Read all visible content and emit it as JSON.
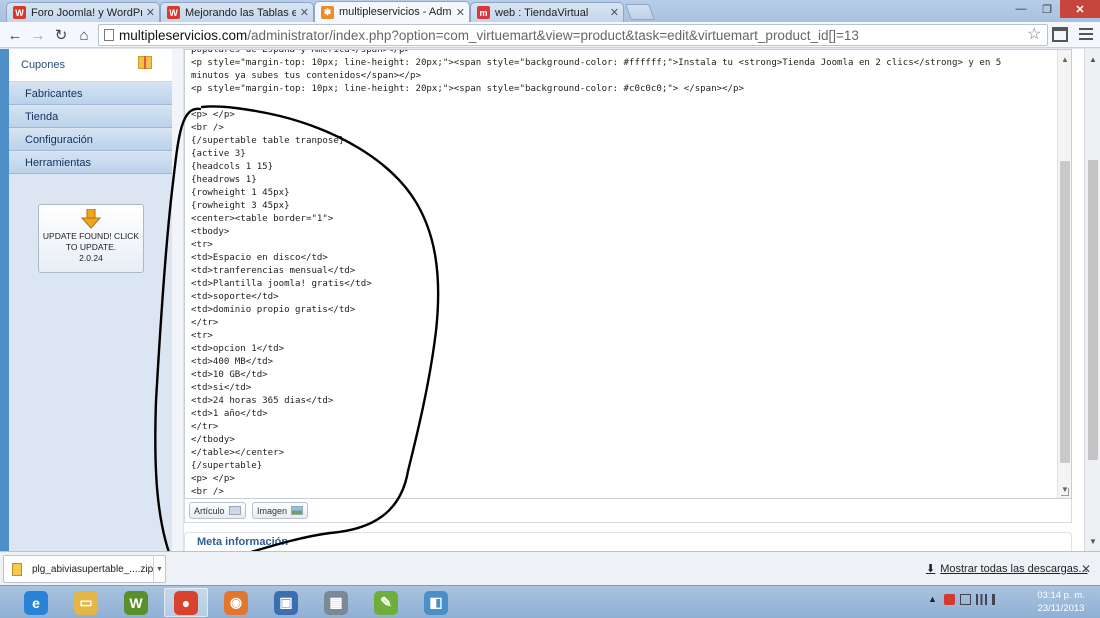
{
  "browser": {
    "tabs": [
      {
        "title": "Foro Joomla! y WordPress",
        "icon": "wordpress-favicon",
        "icon_letter": "W",
        "color": "#d9392c",
        "active": false
      },
      {
        "title": "Mejorando las Tablas en a",
        "icon": "wordpress-favicon",
        "icon_letter": "W",
        "color": "#d9392c",
        "active": false
      },
      {
        "title": "multipleservicios - Admin",
        "icon": "joomla-favicon",
        "icon_letter": "✱",
        "color": "#f08a24",
        "active": true
      },
      {
        "title": "web : TiendaVirtual",
        "icon": "m-favicon",
        "icon_letter": "m",
        "color": "#d63a3a",
        "active": false
      }
    ],
    "address": {
      "host": "multipleservicios.com",
      "rest": "/administrator/index.php?option=com_virtuemart&view=product&task=edit&virtuemart_product_id[]=13"
    }
  },
  "sidebar": {
    "coupon_label": "Cupones",
    "items": [
      "Fabricantes",
      "Tienda",
      "Configuración",
      "Herramientas"
    ],
    "update": {
      "line1": "UPDATE FOUND! CLICK",
      "line2": "TO UPDATE.",
      "version": "2.0.24"
    }
  },
  "editor": {
    "lines": [
      "populares de España y América</span></p>",
      "<p style=\"margin-top: 10px; line-height: 20px;\"><span style=\"background-color: #ffffff;\">Instala tu <strong>Tienda Joomla en 2 clics</strong> y en 5",
      "minutos ya subes tus contenidos</span></p>",
      "<p style=\"margin-top: 10px; line-height: 20px;\"><span style=\"background-color: #c0c0c0;\"> </span></p>",
      "",
      "<p> </p>",
      "<br />",
      "{/supertable table tranpose}",
      "{active 3}",
      "{headcols 1 15}",
      "{headrows 1}",
      "{rowheight 1 45px}",
      "{rowheight 3 45px}",
      "<center><table border=\"1\">",
      "<tbody>",
      "<tr>",
      "<td>Espacio en disco</td>",
      "<td>tranferencias mensual</td>",
      "<td>Plantilla joomla! gratis</td>",
      "<td>soporte</td>",
      "<td>dominio propio gratis</td>",
      "</tr>",
      "<tr>",
      "<td>opcion 1</td>",
      "<td>400 MB</td>",
      "<td>10 GB</td>",
      "<td>si</td>",
      "<td>24 horas 365 dias</td>",
      "<td>1 año</td>",
      "</tr>",
      "</tbody>",
      "</table></center>",
      "{/supertable}",
      "<p> </p>",
      "<br />"
    ],
    "buttons": {
      "article": "Artículo",
      "image": "Imagen"
    },
    "meta_title": "Meta información"
  },
  "downloads": {
    "file": "plg_abiviasupertable_....zip",
    "show_all": "Mostrar todas las descargas..."
  },
  "taskbar": {
    "apps": [
      {
        "name": "internet-explorer",
        "letter": "e",
        "color": "#2a83d6"
      },
      {
        "name": "file-explorer",
        "letter": "▭",
        "color": "#e3b646"
      },
      {
        "name": "wamp-server",
        "letter": "W",
        "color": "#5a8f2b"
      },
      {
        "name": "chrome",
        "letter": "●",
        "color": "#d8432f"
      },
      {
        "name": "firefox",
        "letter": "◉",
        "color": "#e2762b"
      },
      {
        "name": "remote-desktop",
        "letter": "▣",
        "color": "#3b6fb0"
      },
      {
        "name": "calculator",
        "letter": "▦",
        "color": "#7b8896"
      },
      {
        "name": "notepad-plus",
        "letter": "✎",
        "color": "#6fae3a"
      },
      {
        "name": "notepad",
        "letter": "◧",
        "color": "#4a8fc9"
      }
    ],
    "time": "03:14 p. m.",
    "date": "23/11/2013"
  }
}
